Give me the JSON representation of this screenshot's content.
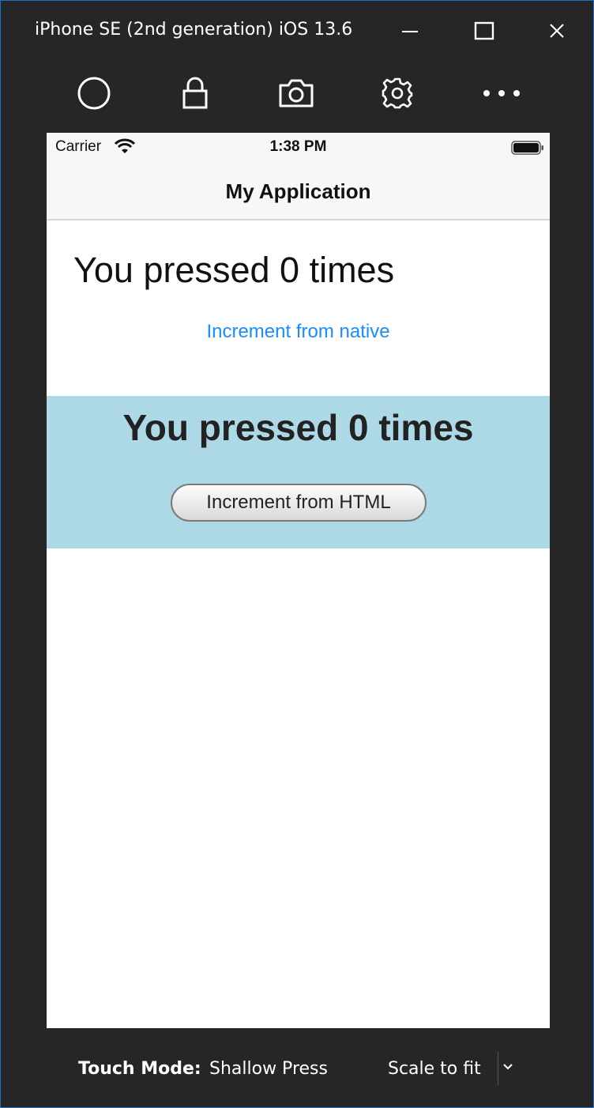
{
  "window": {
    "title": "iPhone SE (2nd generation) iOS 13.6"
  },
  "toolbar": {
    "icons": [
      "home-icon",
      "lock-icon",
      "camera-icon",
      "gear-icon",
      "more-icon"
    ]
  },
  "device": {
    "status_bar": {
      "carrier": "Carrier",
      "time": "1:38 PM"
    },
    "nav_title": "My Application",
    "native": {
      "label": "You pressed 0 times",
      "button": "Increment from native"
    },
    "web": {
      "label": "You pressed 0 times",
      "button": "Increment from HTML",
      "background": "#add8e6"
    }
  },
  "footer": {
    "touch_mode_label": "Touch Mode:",
    "touch_mode_value": "Shallow Press",
    "scale": "Scale to fit"
  },
  "colors": {
    "window_bg": "#262626",
    "accent_border": "#1e73c8",
    "native_link": "#1a8cff"
  }
}
